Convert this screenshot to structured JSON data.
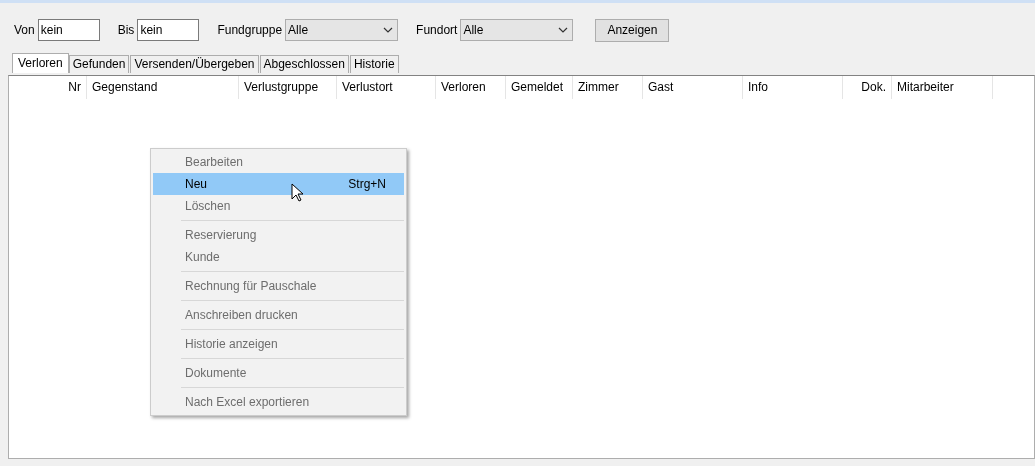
{
  "filters": [
    {
      "kind": "text",
      "label": "Von",
      "value": "kein"
    },
    {
      "kind": "text",
      "label": "Bis",
      "value": "kein"
    },
    {
      "kind": "select",
      "label": "Fundgruppe",
      "value": "Alle"
    },
    {
      "kind": "select",
      "label": "Fundort",
      "value": "Alle"
    }
  ],
  "show_button": "Anzeigen",
  "tabs": [
    {
      "label": "Verloren",
      "selected": true
    },
    {
      "label": "Gefunden",
      "selected": false
    },
    {
      "label": "Versenden/Übergeben",
      "selected": false
    },
    {
      "label": "Abgeschlossen",
      "selected": false
    },
    {
      "label": "Historie",
      "selected": false
    }
  ],
  "table": {
    "columns": [
      {
        "label": "Nr",
        "kind": "numeric"
      },
      {
        "label": "Gegenstand",
        "kind": "text"
      },
      {
        "label": "Verlustgruppe",
        "kind": "text"
      },
      {
        "label": "Verlustort",
        "kind": "text"
      },
      {
        "label": "Verloren",
        "kind": "text"
      },
      {
        "label": "Gemeldet",
        "kind": "text"
      },
      {
        "label": "Zimmer",
        "kind": "text"
      },
      {
        "label": "Gast",
        "kind": "text"
      },
      {
        "label": "Info",
        "kind": "text"
      },
      {
        "label": "Dok.",
        "kind": "numeric"
      },
      {
        "label": "Mitarbeiter",
        "kind": "text"
      }
    ]
  },
  "context_menu": [
    {
      "kind": "item",
      "label": "Bearbeiten",
      "disabled": true,
      "selected": false
    },
    {
      "kind": "item",
      "label": "Neu",
      "shortcut": "Strg+N",
      "disabled": false,
      "selected": true
    },
    {
      "kind": "item",
      "label": "Löschen",
      "disabled": true,
      "selected": false
    },
    {
      "kind": "separator"
    },
    {
      "kind": "item",
      "label": "Reservierung",
      "disabled": true,
      "selected": false
    },
    {
      "kind": "item",
      "label": "Kunde",
      "disabled": true,
      "selected": false
    },
    {
      "kind": "separator"
    },
    {
      "kind": "item",
      "label": "Rechnung für Pauschale",
      "disabled": true,
      "selected": false
    },
    {
      "kind": "separator"
    },
    {
      "kind": "item",
      "label": "Anschreiben drucken",
      "disabled": true,
      "selected": false
    },
    {
      "kind": "separator"
    },
    {
      "kind": "item",
      "label": "Historie anzeigen",
      "disabled": true,
      "selected": false
    },
    {
      "kind": "separator"
    },
    {
      "kind": "item",
      "label": "Dokumente",
      "disabled": true,
      "selected": false
    },
    {
      "kind": "separator"
    },
    {
      "kind": "item",
      "label": "Nach Excel exportieren",
      "disabled": true,
      "selected": false
    }
  ]
}
